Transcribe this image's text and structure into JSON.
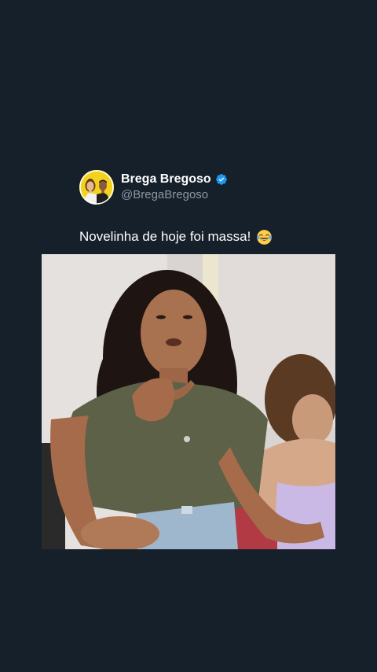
{
  "post": {
    "author": {
      "display_name": "Brega Bregoso",
      "handle": "@BregaBregoso",
      "verified": true,
      "verified_color": "#1d9bf0",
      "avatar_icon": "cartoon-couple-avatar-icon",
      "avatar_bg": "#f3d21e"
    },
    "text": "Novelinha de hoje foi massa!",
    "emoji_icon": "face-with-tears-of-joy-icon",
    "media": {
      "type": "video-frame",
      "icon": "video-still"
    }
  },
  "theme": {
    "background": "#16202b",
    "text_primary": "#ffffff",
    "text_secondary": "#8b98a5"
  }
}
